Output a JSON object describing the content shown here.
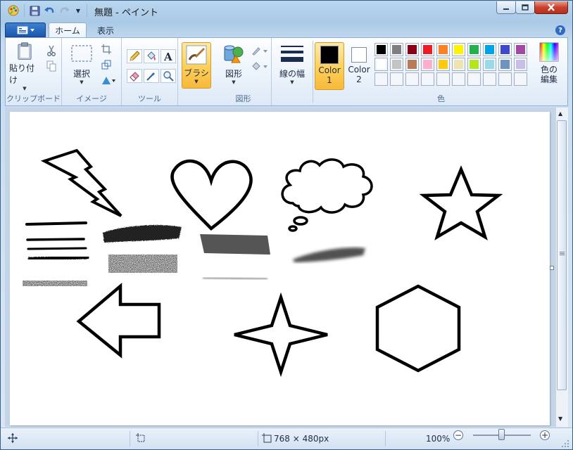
{
  "window": {
    "title": "無題 - ペイント"
  },
  "tabs": [
    {
      "label": "ホーム"
    },
    {
      "label": "表示"
    }
  ],
  "ribbon": {
    "clipboard": {
      "paste_label": "貼り付け",
      "group_label": "クリップボード"
    },
    "image": {
      "select_label": "選択",
      "group_label": "イメージ"
    },
    "tools": {
      "group_label": "ツール"
    },
    "brushes": {
      "label": "ブラシ"
    },
    "shapes": {
      "label": "図形",
      "group_label": "図形"
    },
    "size": {
      "label": "線の幅"
    },
    "colors": {
      "color1_label": "Color",
      "color1_num": "1",
      "color2_label": "Color",
      "color2_num": "2",
      "edit_label_1": "色の",
      "edit_label_2": "編集",
      "group_label": "色",
      "color1_value": "#000000",
      "color2_value": "#ffffff",
      "palette_row1": [
        "#000000",
        "#7f7f7f",
        "#880015",
        "#ed1c24",
        "#ff7f27",
        "#fff200",
        "#22b14c",
        "#00a2e8",
        "#3f48cc",
        "#a349a4"
      ],
      "palette_row2": [
        "#ffffff",
        "#c3c3c3",
        "#b97a57",
        "#ffaec9",
        "#ffc90e",
        "#efe4b0",
        "#b5e61d",
        "#99d9ea",
        "#7092be",
        "#c8bfe7"
      ]
    }
  },
  "status": {
    "image_size": "768 × 480px",
    "zoom": "100%",
    "zoom_fraction": 0.5
  }
}
